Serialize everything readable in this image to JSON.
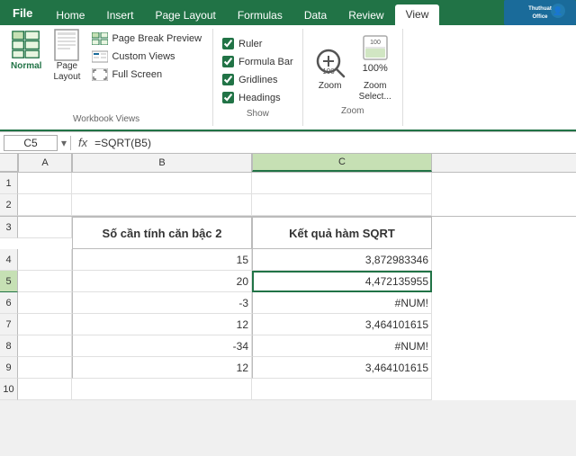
{
  "ribbon": {
    "tabs": [
      {
        "label": "File",
        "active": false
      },
      {
        "label": "Home",
        "active": false
      },
      {
        "label": "Insert",
        "active": false
      },
      {
        "label": "Page Layout",
        "active": false
      },
      {
        "label": "Formulas",
        "active": false
      },
      {
        "label": "Data",
        "active": false
      },
      {
        "label": "Review",
        "active": false
      },
      {
        "label": "View",
        "active": true
      }
    ],
    "workbook_views": {
      "label": "Workbook Views",
      "normal": "Normal",
      "page_layout": "Page\nLayout",
      "page_break_preview": "Page Break Preview",
      "custom_views": "Custom Views",
      "full_screen": "Full Screen"
    },
    "show": {
      "label": "Show",
      "ruler": {
        "label": "Ruler",
        "checked": true
      },
      "formula_bar": {
        "label": "Formula Bar",
        "checked": true
      },
      "gridlines": {
        "label": "Gridlines",
        "checked": true
      },
      "headings": {
        "label": "Headings",
        "checked": true
      }
    },
    "zoom": {
      "label": "Zoom",
      "zoom_btn": "Zoom",
      "pct": "100%",
      "zoom_selection": "Zoom\nSelect..."
    }
  },
  "formula_bar": {
    "cell_ref": "C5",
    "formula": "=SQRT(B5)"
  },
  "spreadsheet": {
    "col_headers": [
      "",
      "A",
      "B",
      "C"
    ],
    "rows": [
      {
        "num": "1",
        "cells": [
          "",
          "",
          ""
        ]
      },
      {
        "num": "2",
        "cells": [
          "",
          "",
          ""
        ]
      },
      {
        "num": "3",
        "cells": [
          "",
          "Số cần tính căn bậc 2",
          "Kết quả hàm SQRT"
        ],
        "is_header": true
      },
      {
        "num": "4",
        "cells": [
          "",
          "15",
          "3,872983346"
        ]
      },
      {
        "num": "5",
        "cells": [
          "",
          "20",
          "4,472135955"
        ],
        "selected_c": true
      },
      {
        "num": "6",
        "cells": [
          "",
          "-3",
          "#NUM!"
        ],
        "is_error_c": true
      },
      {
        "num": "7",
        "cells": [
          "",
          "12",
          "3,464101615"
        ]
      },
      {
        "num": "8",
        "cells": [
          "",
          "-34",
          "#NUM!"
        ],
        "is_error_c": true
      },
      {
        "num": "9",
        "cells": [
          "",
          "12",
          "3,464101615"
        ]
      },
      {
        "num": "10",
        "cells": [
          "",
          "",
          ""
        ]
      }
    ]
  },
  "colors": {
    "excel_green": "#217346",
    "selected_border": "#217346",
    "header_bg": "#f2f2f2",
    "active_col": "#c6e0b4"
  }
}
